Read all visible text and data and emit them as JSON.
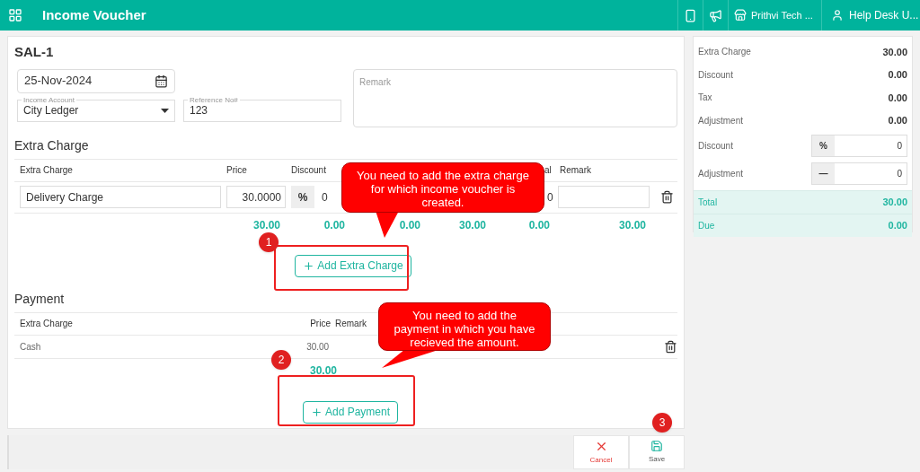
{
  "header": {
    "title": "Income Voucher",
    "company": "Prithvi Tech ...",
    "user": "Help Desk U..."
  },
  "voucher": {
    "number": "SAL-1",
    "date": "25-Nov-2024",
    "income_account": {
      "label": "Income Account",
      "value": "City Ledger"
    },
    "reference": {
      "label": "Reference No#",
      "value": "123"
    },
    "remark": {
      "placeholder": "Remark"
    }
  },
  "extra_charge": {
    "title": "Extra Charge",
    "columns": [
      "Extra Charge",
      "Price",
      "Discount",
      "al",
      "Remark"
    ],
    "rows": [
      {
        "name": "Delivery Charge",
        "price": "30.0000",
        "discount_type": "%",
        "discount": "0",
        "column_4": "0"
      }
    ],
    "totals": [
      "30.00",
      "0.00",
      "0.00",
      "30.00",
      "0.00",
      "30.00"
    ],
    "add_button": "Add Extra Charge"
  },
  "payment": {
    "title": "Payment",
    "columns": [
      "Extra Charge",
      "Price",
      "Remark"
    ],
    "rows": [
      {
        "method": "Cash",
        "price": "30.00"
      }
    ],
    "total": "30.00",
    "add_button": "Add Payment"
  },
  "summary": [
    {
      "kind": "value",
      "label": "Extra Charge",
      "value": "30.00"
    },
    {
      "kind": "value",
      "label": "Discount",
      "value": "0.00"
    },
    {
      "kind": "value",
      "label": "Tax",
      "value": "0.00"
    },
    {
      "kind": "value",
      "label": "Adjustment",
      "value": "0.00"
    },
    {
      "kind": "input",
      "label": "Discount",
      "prefix": "%",
      "value": "0"
    },
    {
      "kind": "input",
      "label": "Adjustment",
      "prefix": "—",
      "value": "0"
    },
    {
      "kind": "total",
      "label": "Total",
      "value": "30.00"
    },
    {
      "kind": "total",
      "label": "Due",
      "value": "0.00"
    }
  ],
  "actions": [
    {
      "kind": "cancel",
      "label": "Cancel"
    },
    {
      "kind": "save",
      "label": "Save"
    }
  ],
  "annotations": {
    "callouts": [
      "You need to add the extra charge for which income voucher is created.",
      "You need to add the payment in which you have recieved the amount."
    ],
    "badges": [
      "1",
      "2",
      "3"
    ]
  }
}
